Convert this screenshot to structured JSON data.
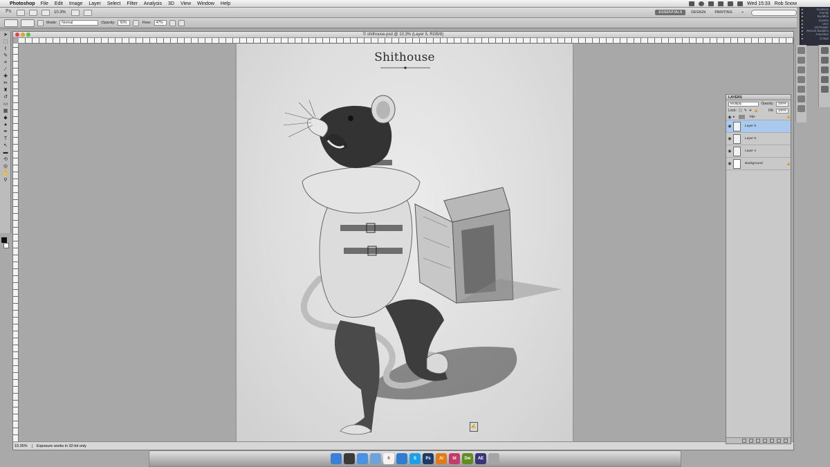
{
  "menubar": {
    "app_name": "Photoshop",
    "menus": [
      "File",
      "Edit",
      "Image",
      "Layer",
      "Select",
      "Filter",
      "Analysis",
      "3D",
      "View",
      "Window",
      "Help"
    ],
    "clock": "Wed 15:33",
    "user": "Rob Snow"
  },
  "appbar": {
    "zoom": "10.3%",
    "workspaces": [
      "ESSENTIALS",
      "DESIGN",
      "PAINTING"
    ],
    "more": "»"
  },
  "options": {
    "mode_label": "Mode:",
    "mode_value": "Normal",
    "opacity_label": "Opacity:",
    "opacity_value": "50%",
    "flow_label": "Flow:",
    "flow_value": "47%"
  },
  "document": {
    "title": "© shithouse.psd @ 10.3% (Layer 5, RGB/8)",
    "artwork_title": "Shithouse",
    "status_zoom": "10.35%",
    "status_message": "Exposure works in 32-bit only"
  },
  "buddy_list": {
    "items": [
      {
        "name": "Students",
        "count": ""
      },
      {
        "name": "Family",
        "count": ""
      },
      {
        "name": "Buddies",
        "count": ""
      },
      {
        "name": "Greeks",
        "count": ""
      },
      {
        "name": "USA",
        "count": ""
      },
      {
        "name": "Twitter",
        "count": "100"
      },
      {
        "name": "Recent Buddies",
        "count": ""
      },
      {
        "name": "Favorites",
        "count": ""
      },
      {
        "name": "Craigs",
        "count": ""
      }
    ]
  },
  "layers_panel": {
    "title": "LAYERS",
    "blend_mode": "Multiply",
    "opacity_label": "Opacity:",
    "opacity_value": "100%",
    "lock_label": "Lock:",
    "fill_label": "Fill:",
    "fill_value": "100%",
    "layers": [
      {
        "name": "Title",
        "type": "group",
        "locked": true
      },
      {
        "name": "Layer 5",
        "selected": true
      },
      {
        "name": "Layer 6"
      },
      {
        "name": "Layer 4"
      },
      {
        "name": "Background",
        "locked": true
      }
    ]
  },
  "dock": {
    "apps": [
      {
        "name": "finder-icon",
        "color": "#3b7fd6",
        "label": ""
      },
      {
        "name": "dashboard-icon",
        "color": "#3a3a3a",
        "label": ""
      },
      {
        "name": "app-store-icon",
        "color": "#4b91e2",
        "label": ""
      },
      {
        "name": "mail-icon",
        "color": "#6fa2d8",
        "label": ""
      },
      {
        "name": "calendar-icon",
        "color": "#f4f4f4",
        "label": "6"
      },
      {
        "name": "safari-icon",
        "color": "#2f7dd0",
        "label": ""
      },
      {
        "name": "skype-icon",
        "color": "#1aa0e6",
        "label": "S"
      },
      {
        "name": "photoshop-icon",
        "color": "#1e3a68",
        "label": "Ps"
      },
      {
        "name": "illustrator-icon",
        "color": "#e37a1a",
        "label": "Ai"
      },
      {
        "name": "indesign-icon",
        "color": "#c43a6b",
        "label": "Id"
      },
      {
        "name": "dreamweaver-icon",
        "color": "#5f8d1e",
        "label": "Dw"
      },
      {
        "name": "after-effects-icon",
        "color": "#3b3577",
        "label": "AE"
      },
      {
        "name": "trash-icon",
        "color": "#a5a5a5",
        "label": ""
      }
    ]
  }
}
